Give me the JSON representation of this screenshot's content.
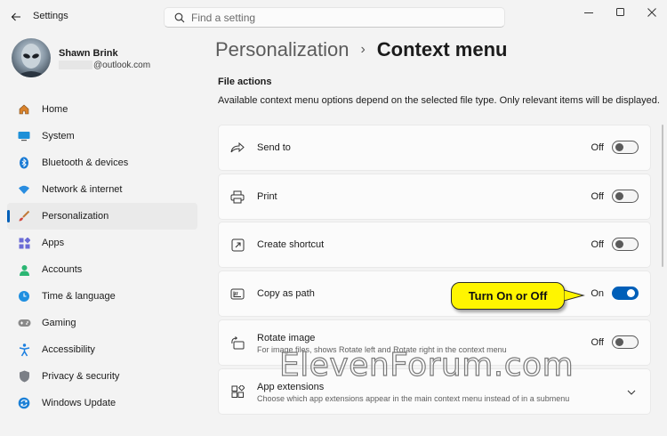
{
  "window": {
    "title": "Settings",
    "search_placeholder": "Find a setting"
  },
  "profile": {
    "name": "Shawn Brink",
    "email_domain": "@outlook.com"
  },
  "sidebar": {
    "items": [
      {
        "label": "Home",
        "icon": "home-icon"
      },
      {
        "label": "System",
        "icon": "system-icon"
      },
      {
        "label": "Bluetooth & devices",
        "icon": "bluetooth-icon"
      },
      {
        "label": "Network & internet",
        "icon": "wifi-icon"
      },
      {
        "label": "Personalization",
        "icon": "brush-icon",
        "active": true
      },
      {
        "label": "Apps",
        "icon": "apps-icon"
      },
      {
        "label": "Accounts",
        "icon": "accounts-icon"
      },
      {
        "label": "Time & language",
        "icon": "globe-clock-icon"
      },
      {
        "label": "Gaming",
        "icon": "gamepad-icon"
      },
      {
        "label": "Accessibility",
        "icon": "accessibility-icon"
      },
      {
        "label": "Privacy & security",
        "icon": "shield-icon"
      },
      {
        "label": "Windows Update",
        "icon": "update-icon"
      }
    ]
  },
  "breadcrumb": {
    "parent": "Personalization",
    "separator": "›",
    "current": "Context menu"
  },
  "section": {
    "title": "File actions",
    "description": "Available context menu options depend on the selected file type. Only relevant items will be displayed."
  },
  "settings": [
    {
      "label": "Send to",
      "state": "Off",
      "on": false,
      "icon": "share-arrow-icon"
    },
    {
      "label": "Print",
      "state": "Off",
      "on": false,
      "icon": "printer-icon"
    },
    {
      "label": "Create shortcut",
      "state": "Off",
      "on": false,
      "icon": "shortcut-icon"
    },
    {
      "label": "Copy as path",
      "state": "On",
      "on": true,
      "icon": "copy-path-icon"
    },
    {
      "label": "Rotate image",
      "sub": "For image files, shows Rotate left and Rotate right in the context menu",
      "state": "Off",
      "on": false,
      "icon": "rotate-icon"
    },
    {
      "label": "App extensions",
      "sub": "Choose which app extensions appear in the main context menu instead of in a submenu",
      "icon": "extensions-icon",
      "expandable": true
    }
  ],
  "callout": {
    "text": "Turn On or Off",
    "color": "#fff500"
  },
  "watermark": "ElevenForum.com",
  "accent_color": "#005fb8"
}
